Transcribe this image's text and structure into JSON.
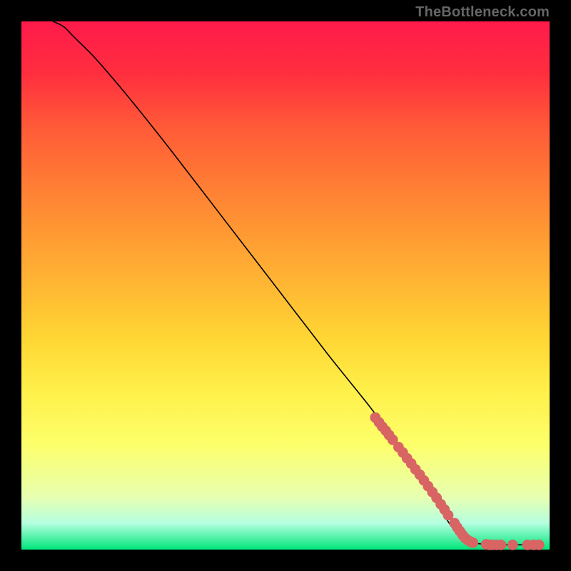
{
  "watermark": "TheBottleneck.com",
  "chart_data": {
    "type": "line",
    "title": "",
    "xlabel": "",
    "ylabel": "",
    "xlim": [
      0,
      100
    ],
    "ylim": [
      0,
      100
    ],
    "curve": {
      "name": "curve",
      "x": [
        6,
        8,
        10,
        14,
        20,
        28,
        38,
        48,
        58,
        66,
        72,
        76,
        79,
        81,
        82.5,
        84,
        86,
        88,
        90,
        92,
        94,
        96,
        98
      ],
      "y": [
        100,
        99,
        97,
        93,
        86,
        76,
        63,
        50,
        37,
        27,
        19,
        13,
        8,
        5,
        3,
        1.7,
        1.2,
        1.0,
        0.9,
        0.9,
        0.9,
        0.9,
        0.9
      ]
    },
    "series": [
      {
        "name": "markers",
        "color": "#d86464",
        "radius": 1.0,
        "x": [
          67.0,
          67.7,
          68.3,
          69.0,
          69.6,
          70.3,
          71.4,
          72.2,
          73.0,
          73.8,
          74.6,
          75.4,
          76.2,
          77.0,
          77.8,
          78.6,
          79.4,
          80.1,
          80.8,
          82.0,
          82.5,
          83.0,
          83.5,
          84.0,
          84.5,
          85.0,
          85.5,
          88.0,
          88.6,
          89.2,
          90.0,
          90.8,
          93.0,
          95.8,
          97.0,
          98.0
        ],
        "y": [
          25.0,
          24.1,
          23.3,
          22.5,
          21.7,
          20.8,
          19.4,
          18.4,
          17.3,
          16.3,
          15.2,
          14.2,
          13.1,
          12.0,
          10.9,
          9.8,
          8.6,
          7.6,
          6.5,
          5.0,
          4.2,
          3.5,
          2.8,
          2.2,
          1.8,
          1.5,
          1.3,
          1.0,
          0.9,
          0.9,
          0.9,
          0.9,
          0.9,
          0.9,
          0.9,
          0.9
        ]
      }
    ]
  }
}
